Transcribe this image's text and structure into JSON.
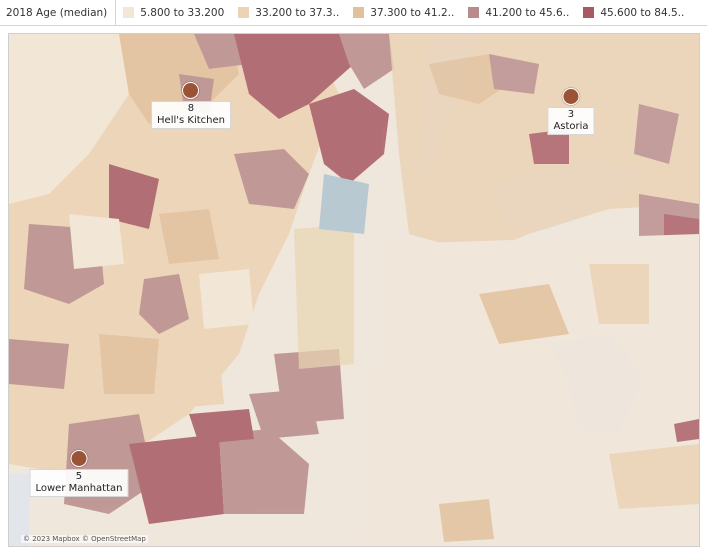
{
  "legend": {
    "title": "2018 Age (median)",
    "items": [
      {
        "label": "5.800 to 33.200",
        "color": "#f3e6d6"
      },
      {
        "label": "33.200 to 37.3..",
        "color": "#ecd3b4"
      },
      {
        "label": "37.300 to 41.2..",
        "color": "#e2c09a"
      },
      {
        "label": "41.200 to 45.6..",
        "color": "#b88c8c"
      },
      {
        "label": "45.600 to 84.5..",
        "color": "#a85a64"
      }
    ]
  },
  "markers": [
    {
      "count": "8",
      "name": "Hell's Kitchen"
    },
    {
      "count": "3",
      "name": "Astoria"
    },
    {
      "count": "5",
      "name": "Lower Manhattan"
    }
  ],
  "attribution": "© 2023 Mapbox © OpenStreetMap"
}
